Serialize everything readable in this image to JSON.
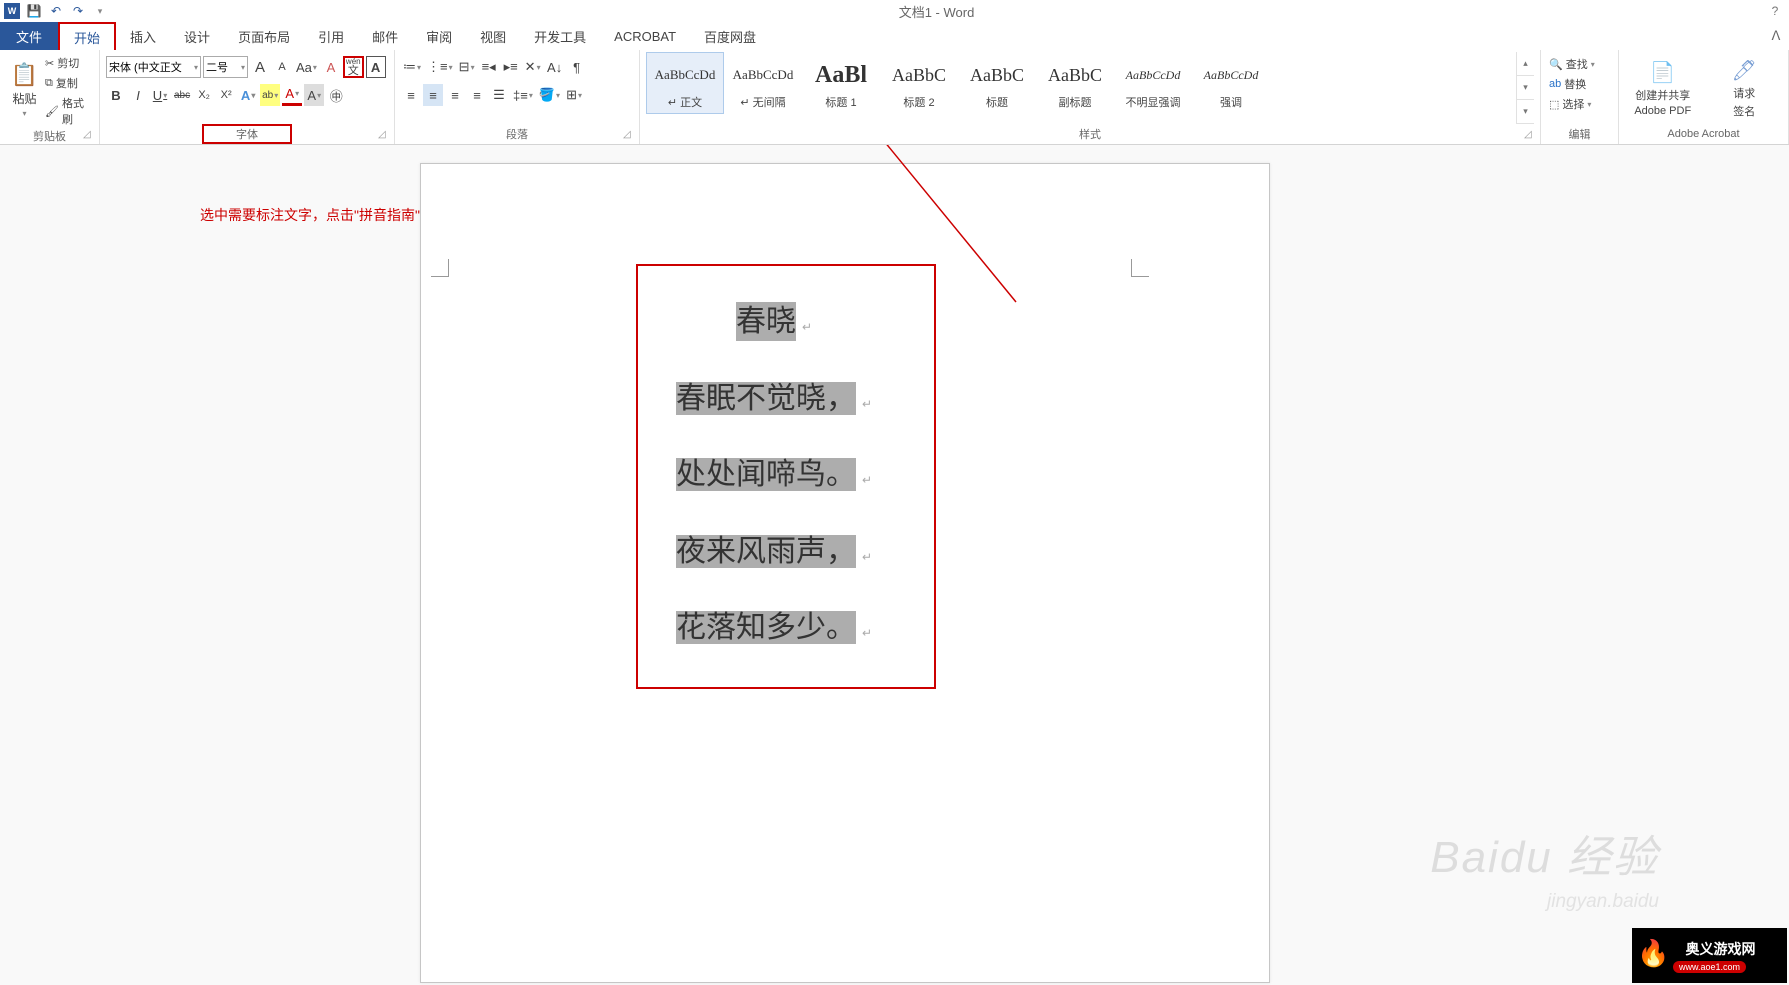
{
  "titleBar": {
    "docTitle": "文档1 - Word",
    "helpIcon": "?"
  },
  "tabs": {
    "file": "文件",
    "home": "开始",
    "insert": "插入",
    "design": "设计",
    "layout": "页面布局",
    "references": "引用",
    "mail": "邮件",
    "review": "审阅",
    "view": "视图",
    "dev": "开发工具",
    "acrobat": "ACROBAT",
    "baidu": "百度网盘"
  },
  "clipboard": {
    "paste": "粘贴",
    "cut": "剪切",
    "copy": "复制",
    "format": "格式刷",
    "label": "剪贴板"
  },
  "font": {
    "name": "宋体 (中文正文",
    "size": "二号",
    "bold": "B",
    "italic": "I",
    "underline": "U",
    "strike": "abc",
    "sub": "X₂",
    "sup": "X²",
    "growA": "A",
    "shrinkA": "A",
    "caseAa": "Aa",
    "clearA": "A",
    "pinyin": "wén",
    "pinyinSub": "文",
    "charBorder": "A",
    "textEffect": "A",
    "highlight": "ab",
    "fontColor": "A",
    "shadingA": "A",
    "circleA": "㊥",
    "label": "字体"
  },
  "paragraph": {
    "label": "段落"
  },
  "styles": {
    "label": "样式",
    "items": [
      {
        "preview": "AaBbCcDd",
        "name": "↵ 正文",
        "size": "13px",
        "active": true
      },
      {
        "preview": "AaBbCcDd",
        "name": "↵ 无间隔",
        "size": "13px"
      },
      {
        "preview": "AaBl",
        "name": "标题 1",
        "size": "24px",
        "bold": true
      },
      {
        "preview": "AaBbC",
        "name": "标题 2",
        "size": "18px"
      },
      {
        "preview": "AaBbC",
        "name": "标题",
        "size": "18px"
      },
      {
        "preview": "AaBbC",
        "name": "副标题",
        "size": "18px"
      },
      {
        "preview": "AaBbCcDd",
        "name": "不明显强调",
        "size": "12px",
        "italic": true
      },
      {
        "preview": "AaBbCcDd",
        "name": "强调",
        "size": "12px",
        "italic": true
      }
    ]
  },
  "editing": {
    "find": "查找",
    "replace": "替换",
    "select": "选择",
    "label": "编辑"
  },
  "acrobat": {
    "createShare": "创建并共享",
    "adobePdf": "Adobe PDF",
    "requestSign": "请求",
    "sign": "签名",
    "label": "Adobe Acrobat"
  },
  "annotation": {
    "text": "选中需要标注文字，点击\"拼音指南\""
  },
  "document": {
    "poemTitle": "春晓",
    "lines": [
      "春眠不觉晓，",
      "处处闻啼鸟。",
      "夜来风雨声，",
      "花落知多少。"
    ]
  },
  "watermark": {
    "main": "Baidu 经验",
    "sub": "jingyan.baidu"
  },
  "cornerLogo": {
    "text": "奥义游戏网",
    "url": "www.aoe1.com"
  }
}
